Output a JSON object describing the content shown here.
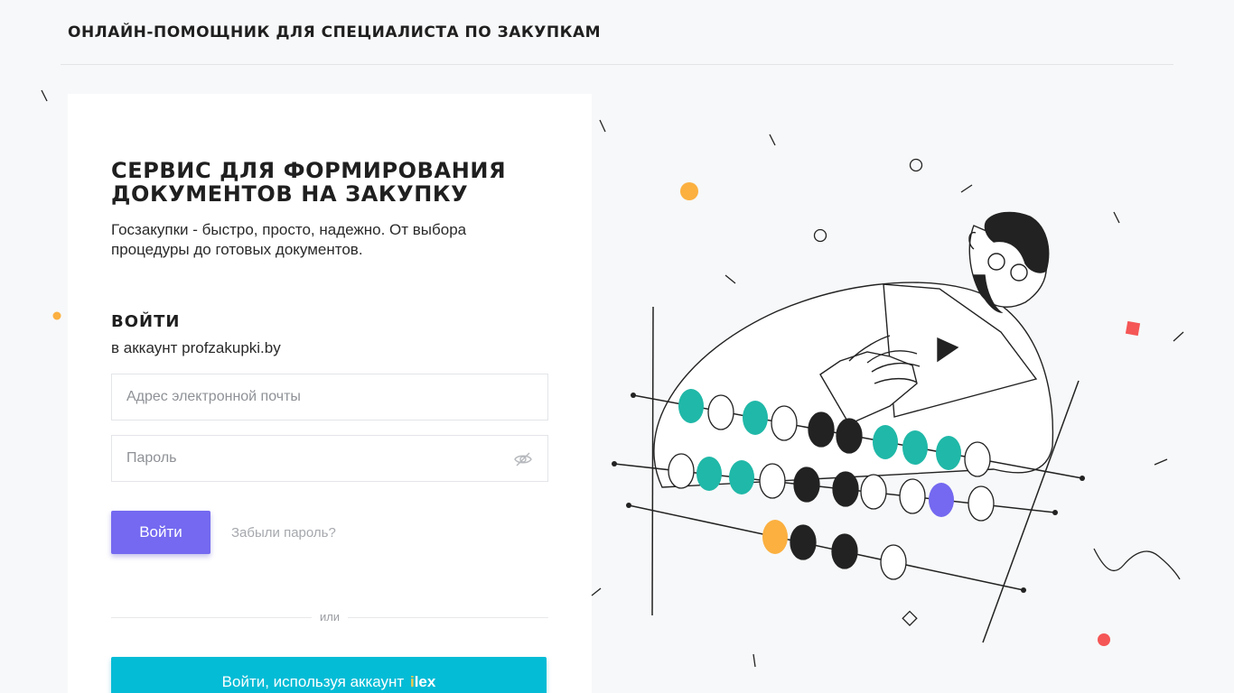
{
  "header": {
    "brand": "ОНЛАЙН-ПОМОЩНИК ДЛЯ СПЕЦИАЛИСТА ПО ЗАКУПКАМ"
  },
  "card": {
    "headline": "СЕРВИС ДЛЯ ФОРМИРОВАНИЯ ДОКУМЕНТОВ НА ЗАКУПКУ",
    "subtitle": "Госзакупки - быстро, просто, надежно. От выбора процедуры до готовых документов."
  },
  "login": {
    "title": "ВОЙТИ",
    "subtitle": "в аккаунт profzakupki.by",
    "email_placeholder": "Адрес электронной почты",
    "email_value": "",
    "password_placeholder": "Пароль",
    "password_value": "",
    "submit_label": "Войти",
    "forgot_label": "Забыли пароль?",
    "or_label": "или",
    "ilex_button_label": "Войти, используя аккаунт",
    "ilex_logo_i": "i",
    "ilex_logo_rest": "lex"
  },
  "icons": {
    "password_toggle": "eye-slash-icon"
  },
  "colors": {
    "primary_button": "#7469f0",
    "ilex_button": "#05bcd6",
    "accent_teal": "#20b8a8",
    "accent_orange": "#fbb040",
    "accent_red": "#f55656",
    "accent_purple": "#7469f0"
  }
}
